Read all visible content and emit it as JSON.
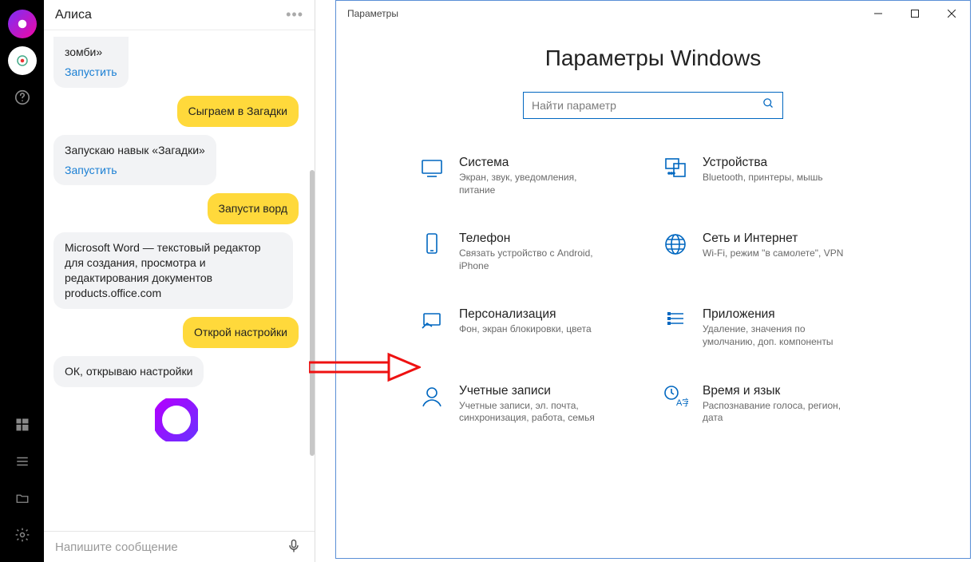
{
  "alice": {
    "title": "Алиса",
    "input_placeholder": "Напишите сообщение",
    "run_link": "Запустить",
    "messages": [
      {
        "role": "bot",
        "text": "зомби»",
        "truncated_top": true,
        "has_run": true
      },
      {
        "role": "user",
        "text": "Сыграем в Загадки"
      },
      {
        "role": "bot",
        "text": "Запускаю навык «Загадки»",
        "has_run": true
      },
      {
        "role": "user",
        "text": "Запусти ворд"
      },
      {
        "role": "bot",
        "text": "Microsoft Word — текстовый редактор для создания, просмотра и редактирования документов products.office.com"
      },
      {
        "role": "user",
        "text": "Открой настройки"
      },
      {
        "role": "bot",
        "text": "ОК, открываю настройки"
      }
    ]
  },
  "settings": {
    "window_title": "Параметры",
    "heading": "Параметры Windows",
    "search_placeholder": "Найти параметр",
    "categories": [
      {
        "icon": "display",
        "title": "Система",
        "desc": "Экран, звук, уведомления, питание"
      },
      {
        "icon": "devices",
        "title": "Устройства",
        "desc": "Bluetooth, принтеры, мышь"
      },
      {
        "icon": "phone",
        "title": "Телефон",
        "desc": "Связать устройство с Android, iPhone"
      },
      {
        "icon": "network",
        "title": "Сеть и Интернет",
        "desc": "Wi-Fi, режим \"в самолете\", VPN"
      },
      {
        "icon": "personalization",
        "title": "Персонализация",
        "desc": "Фон, экран блокировки, цвета"
      },
      {
        "icon": "apps",
        "title": "Приложения",
        "desc": "Удаление, значения по умолчанию, доп. компоненты"
      },
      {
        "icon": "accounts",
        "title": "Учетные записи",
        "desc": "Учетные записи, эл. почта, синхронизация, работа, семья"
      },
      {
        "icon": "time",
        "title": "Время и язык",
        "desc": "Распознавание голоса, регион, дата"
      }
    ]
  }
}
